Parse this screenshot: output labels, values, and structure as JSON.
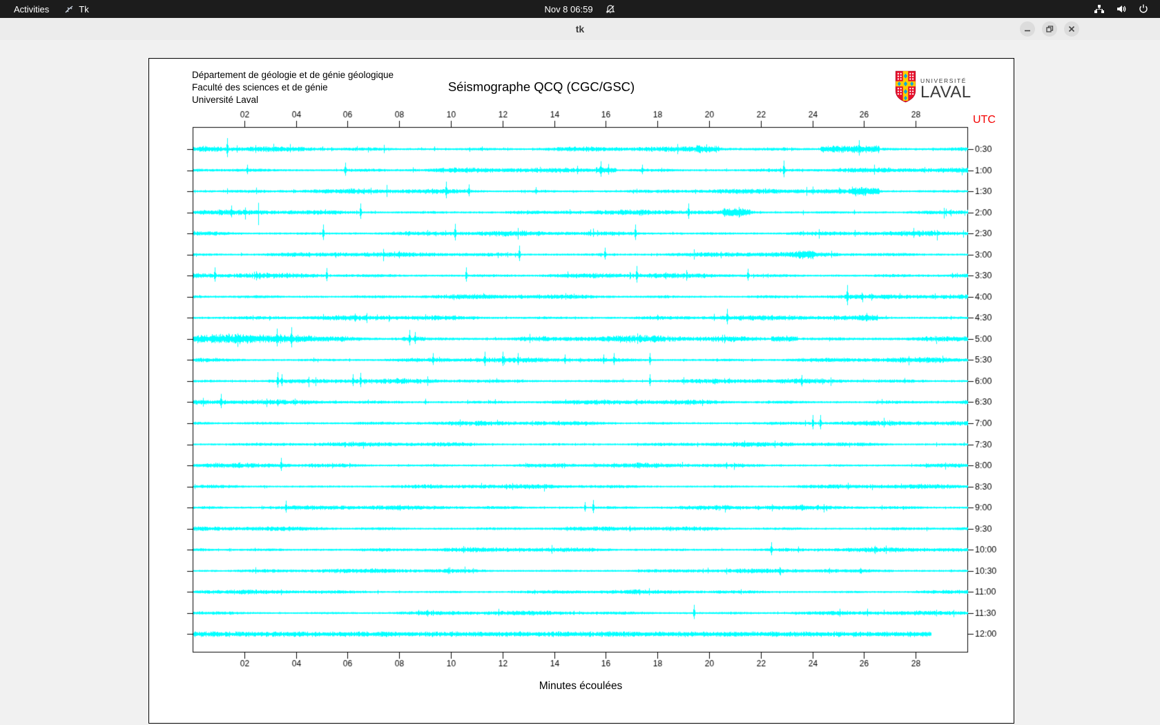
{
  "topbar": {
    "activities": "Activities",
    "app_name": "Tk",
    "clock": "Nov 8 06:59"
  },
  "titlebar": {
    "title": "tk"
  },
  "seismograph": {
    "header_lines": [
      "Département de géologie et de génie géologique",
      "Faculté des sciences et de génie",
      "Université Laval"
    ],
    "logo": {
      "line1": "UNIVERSITÉ",
      "line2": "LAVAL"
    }
  },
  "chart_data": {
    "type": "line",
    "title": "Séismographe QCQ (CGC/GSC)",
    "xlabel": "Minutes écoulées",
    "utc_label": "UTC",
    "xlim": [
      0,
      30
    ],
    "x_tick_minutes": [
      2,
      4,
      6,
      8,
      10,
      12,
      14,
      16,
      18,
      20,
      22,
      24,
      26,
      28
    ],
    "x_tick_labels": [
      "02",
      "04",
      "06",
      "08",
      "10",
      "12",
      "14",
      "16",
      "18",
      "20",
      "22",
      "24",
      "26",
      "28"
    ],
    "grid": false,
    "legend": "none",
    "colors": {
      "trace": "#00ffff",
      "axis": "#000000",
      "utc": "#f30000",
      "topbar_bg": "#1c1c1c",
      "titlebar_bg": "#ececec",
      "desktop_bg": "#f1f1f1",
      "canvas_bg": "#ffffff",
      "laval_red": "#e8112d",
      "laval_gold": "#ffcd00",
      "laval_blue": "#00a9e0"
    },
    "rows": [
      {
        "utc": "0:30",
        "noise": 1.5,
        "end": 30,
        "spikes": [
          [
            1.35,
            16
          ],
          [
            9.35,
            4
          ],
          [
            11.2,
            4
          ],
          [
            19.9,
            7
          ],
          [
            24.8,
            5
          ],
          [
            25.8,
            13
          ]
        ],
        "bursts": [
          [
            0.2,
            1.1,
            1.0
          ],
          [
            19.5,
            20.4,
            1.5
          ],
          [
            24.3,
            26.6,
            2.2
          ]
        ]
      },
      {
        "utc": "1:00",
        "noise": 1.5,
        "end": 30,
        "spikes": [
          [
            2.1,
            8
          ],
          [
            5.9,
            11
          ],
          [
            15.8,
            13
          ],
          [
            16.1,
            9
          ],
          [
            17.4,
            8
          ],
          [
            22.9,
            14
          ]
        ],
        "bursts": [
          [
            15.6,
            16.4,
            1.5
          ]
        ]
      },
      {
        "utc": "1:30",
        "noise": 1.5,
        "end": 30,
        "spikes": [
          [
            9.8,
            14
          ],
          [
            10.7,
            10
          ],
          [
            13.3,
            6
          ],
          [
            25.9,
            6
          ]
        ],
        "bursts": [
          [
            25.4,
            26.6,
            2.2
          ]
        ]
      },
      {
        "utc": "2:00",
        "noise": 1.5,
        "end": 30,
        "spikes": [
          [
            1.5,
            10
          ],
          [
            6.5,
            13
          ],
          [
            19.2,
            13
          ],
          [
            21.0,
            6
          ]
        ],
        "bursts": [
          [
            20.5,
            21.6,
            2.0
          ]
        ]
      },
      {
        "utc": "2:30",
        "noise": 1.5,
        "end": 30,
        "spikes": [
          [
            5.05,
            13
          ],
          [
            10.15,
            14
          ],
          [
            17.15,
            13
          ]
        ],
        "bursts": []
      },
      {
        "utc": "3:00",
        "noise": 1.5,
        "end": 30,
        "spikes": [
          [
            12.65,
            13
          ],
          [
            15.95,
            10
          ],
          [
            23.7,
            5
          ]
        ],
        "bursts": [
          [
            23.3,
            24.1,
            1.8
          ]
        ]
      },
      {
        "utc": "3:30",
        "noise": 1.5,
        "end": 30,
        "spikes": [
          [
            0.85,
            12
          ],
          [
            5.2,
            11
          ],
          [
            10.6,
            12
          ],
          [
            17.2,
            14
          ],
          [
            21.5,
            10
          ]
        ],
        "bursts": []
      },
      {
        "utc": "4:00",
        "noise": 1.4,
        "end": 30,
        "spikes": [
          [
            25.35,
            17
          ],
          [
            25.9,
            6
          ]
        ],
        "bursts": []
      },
      {
        "utc": "4:30",
        "noise": 1.5,
        "end": 30,
        "spikes": [
          [
            20.7,
            13
          ],
          [
            26.1,
            7
          ]
        ],
        "bursts": [
          [
            25.8,
            26.5,
            1.5
          ]
        ]
      },
      {
        "utc": "5:00",
        "noise": 2.1,
        "end": 30,
        "spikes": [
          [
            3.26,
            15
          ],
          [
            3.82,
            17
          ],
          [
            8.4,
            13
          ],
          [
            8.6,
            10
          ],
          [
            20.5,
            6
          ],
          [
            23.0,
            5
          ]
        ],
        "bursts": [
          [
            0,
            4.6,
            1.2
          ],
          [
            8.1,
            9.0,
            0.8
          ],
          [
            22.4,
            23.4,
            1.5
          ]
        ]
      },
      {
        "utc": "5:30",
        "noise": 1.5,
        "end": 30,
        "spikes": [
          [
            9.3,
            10
          ],
          [
            11.3,
            12
          ],
          [
            12.0,
            12
          ],
          [
            12.6,
            10
          ],
          [
            14.4,
            8
          ],
          [
            15.9,
            8
          ],
          [
            16.3,
            10
          ],
          [
            17.7,
            10
          ]
        ],
        "bursts": []
      },
      {
        "utc": "6:00",
        "noise": 1.5,
        "end": 30,
        "spikes": [
          [
            3.3,
            13
          ],
          [
            3.45,
            10
          ],
          [
            6.2,
            10
          ],
          [
            6.5,
            12
          ],
          [
            17.7,
            10
          ]
        ],
        "bursts": []
      },
      {
        "utc": "6:30",
        "noise": 1.5,
        "end": 30,
        "spikes": [
          [
            1.1,
            12
          ],
          [
            9.0,
            5
          ]
        ],
        "bursts": []
      },
      {
        "utc": "7:00",
        "noise": 1.4,
        "end": 30,
        "spikes": [
          [
            24.0,
            12
          ],
          [
            24.3,
            12
          ]
        ],
        "bursts": []
      },
      {
        "utc": "7:30",
        "noise": 1.3,
        "end": 30,
        "spikes": [],
        "bursts": []
      },
      {
        "utc": "8:00",
        "noise": 1.4,
        "end": 30,
        "spikes": [
          [
            3.42,
            11
          ]
        ],
        "bursts": []
      },
      {
        "utc": "8:30",
        "noise": 1.3,
        "end": 30,
        "spikes": [],
        "bursts": []
      },
      {
        "utc": "9:00",
        "noise": 1.4,
        "end": 30,
        "spikes": [
          [
            3.6,
            10
          ],
          [
            15.2,
            8
          ],
          [
            15.5,
            11
          ]
        ],
        "bursts": []
      },
      {
        "utc": "9:30",
        "noise": 1.3,
        "end": 30,
        "spikes": [],
        "bursts": []
      },
      {
        "utc": "10:00",
        "noise": 1.4,
        "end": 30,
        "spikes": [
          [
            22.4,
            11
          ]
        ],
        "bursts": []
      },
      {
        "utc": "10:30",
        "noise": 1.3,
        "end": 30,
        "spikes": [],
        "bursts": []
      },
      {
        "utc": "11:00",
        "noise": 1.2,
        "end": 30,
        "spikes": [],
        "bursts": []
      },
      {
        "utc": "11:30",
        "noise": 1.3,
        "end": 30,
        "spikes": [
          [
            19.4,
            12
          ]
        ],
        "bursts": []
      },
      {
        "utc": "12:00",
        "noise": 1.9,
        "end": 28.6,
        "flat": true,
        "spikes": [],
        "bursts": []
      }
    ]
  }
}
